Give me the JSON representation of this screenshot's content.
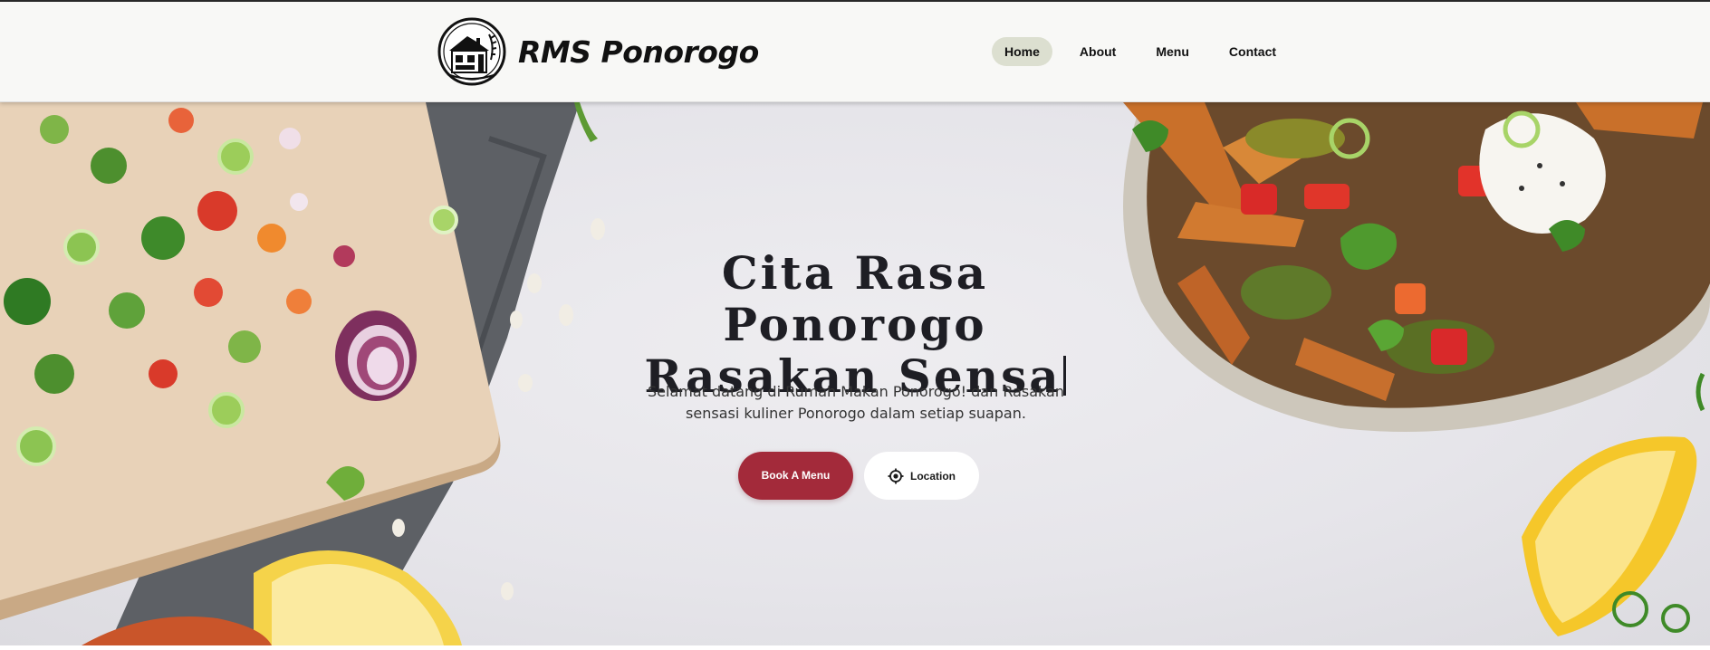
{
  "brand": {
    "name": "RMS Ponorogo",
    "logo_icon": "restaurant-house-logo"
  },
  "nav": {
    "items": [
      {
        "label": "Home",
        "active": true
      },
      {
        "label": "About",
        "active": false
      },
      {
        "label": "Menu",
        "active": false
      },
      {
        "label": "Contact",
        "active": false
      }
    ]
  },
  "hero": {
    "title_line1": "Cita Rasa Ponorogo",
    "title_line2": "Rasakan Sensa",
    "subtitle": "Selamat datang di Rumah Makan Ponorogo! dan Rasakan sensasi kuliner Ponorogo dalam setiap suapan.",
    "book_button": "Book A Menu",
    "location_button": "Location",
    "location_icon": "crosshair-location-icon"
  },
  "colors": {
    "accent": "#a32a3a",
    "nav_active_bg": "#dcdfd0",
    "navbar_bg": "#f8f8f6",
    "hero_bg": "#e6e5ea"
  }
}
